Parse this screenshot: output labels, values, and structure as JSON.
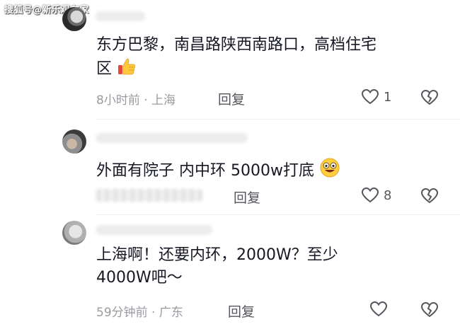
{
  "watermark": "搜狐号@新乐观在家",
  "comments": [
    {
      "text_line1": "东方巴黎，南昌路陕西南路口，高档住宅",
      "text_line2": "区",
      "emoji_name": "thumbs-up-icon",
      "meta": "8小时前 · 上海",
      "reply": "回复",
      "likes": "1"
    },
    {
      "text_line1": "外面有院子  内中环  5000w打底",
      "emoji_name": "grinning-face-icon",
      "reply": "回复",
      "likes": "8"
    },
    {
      "text_line1": "上海啊！还要内环，2000W？至少",
      "text_line2": "4000W吧～",
      "meta": "59分钟前 · 广东",
      "reply": "回复",
      "likes": ""
    }
  ],
  "colors": {
    "text": "#161823",
    "meta": "#9a9ba1",
    "icon": "#55565c"
  }
}
